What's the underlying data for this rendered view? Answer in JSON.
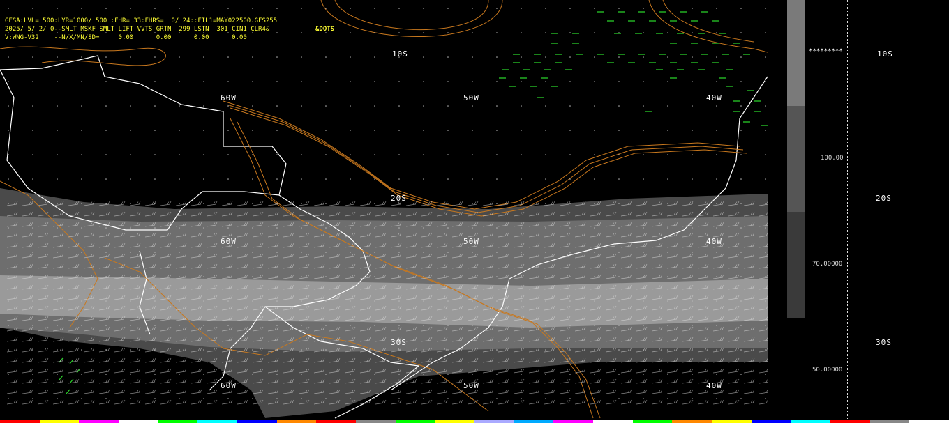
{
  "header": {
    "line1": "GFSA:LVL= 500:LYR=1000/ 500 :FHR= 33:FHRS=  0/ 24::FIL1=MAY022500.GFS255",
    "line2": "2025/ 5/ 2/ 0--SMLT MSKF SMLT LIFT VVTS GRTN  299 LSTN  301 CIN1 CLR4&",
    "line3": "V:WNG-V32    --N/X/MN/SD=     0.00      0.00      0.00      0.00",
    "dots_label": "&DOTS"
  },
  "map_labels": {
    "lat_10s": "10S",
    "lat_20s": "20S",
    "lat_30s": "30S",
    "lon_60w": "60W",
    "lon_50w": "50W",
    "lon_40w": "40W"
  },
  "side_panel": {
    "stars": "*********",
    "scale_values": [
      "100.00",
      "70.00000",
      "50.00000"
    ],
    "lat_labels": [
      "10S",
      "20S",
      "30S"
    ]
  },
  "colors": {
    "background": "#000000",
    "header_text": "#ffff33",
    "coastline": "#ffffff",
    "contour": "#c8781e",
    "wind_barbs_top": "#2bd42b",
    "shade_light": "#9a9a9a",
    "shade_mid": "#6e6e6e",
    "shade_dark": "#4a4a4a",
    "legend_top": "#7a7a7a",
    "legend_mid": "#555555",
    "legend_bottom": "#3a3a3a"
  },
  "bottom_bar_colors": [
    "#ff0000",
    "#ffff00",
    "#ff00ff",
    "#ffffff",
    "#00ff00",
    "#00ffff",
    "#0000ff",
    "#ff8800",
    "#ff0000",
    "#888888",
    "#00ff00",
    "#ffff00",
    "#aaaaff",
    "#00aaff",
    "#ff00ff",
    "#ffffff",
    "#00ff00",
    "#ff8800",
    "#ffff00",
    "#0000ff",
    "#00ffff",
    "#ff0000",
    "#888888",
    "#ffffff"
  ]
}
